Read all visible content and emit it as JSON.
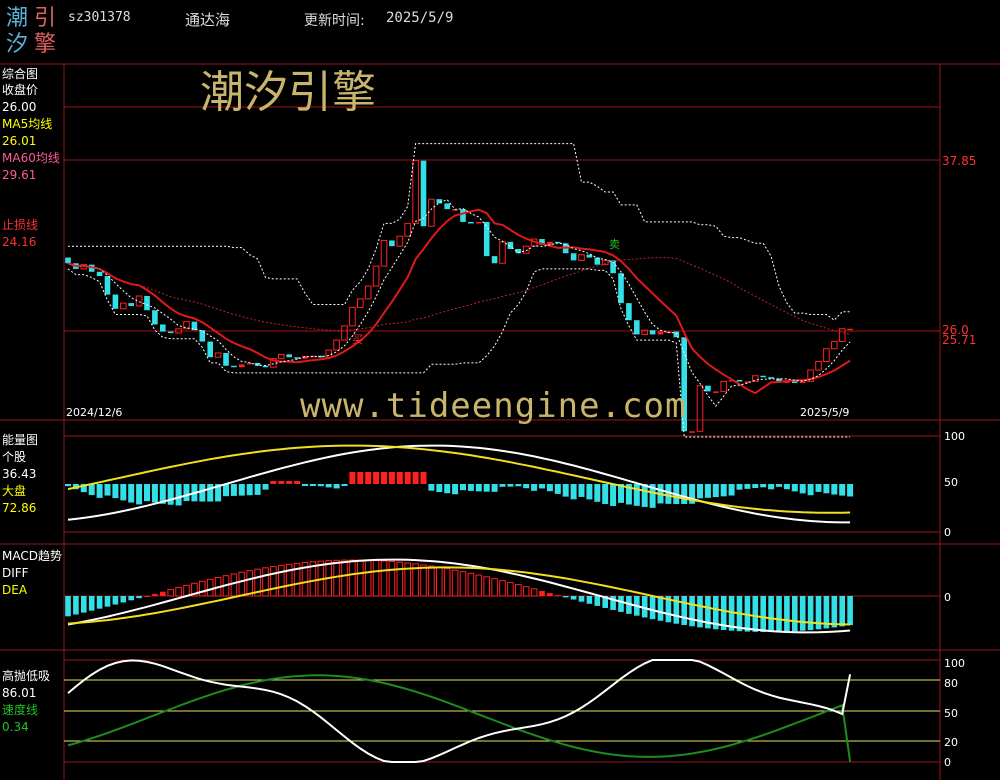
{
  "header": {
    "logo_chars": [
      "潮",
      "引",
      "汐",
      "擎"
    ],
    "code": "sz301378",
    "name": "通达海",
    "update_label": "更新时间:",
    "update_date": "2025/5/9"
  },
  "watermarks": {
    "brand": "潮汐引擎",
    "url": "www.tideengine.com"
  },
  "panels": {
    "main": {
      "title": "综合图",
      "close_label": "收盘价",
      "close_value": "26.00",
      "ma5_label": "MA5均线",
      "ma5_value": "26.01",
      "ma60_label": "MA60均线",
      "ma60_value": "29.61",
      "stop_label": "止损线",
      "stop_value": "24.16",
      "date_start": "2024/12/6",
      "date_end": "2025/5/9",
      "right_top": "37.85",
      "right_mid1": "26.0",
      "right_mid2": "25.71",
      "marker_red": "买",
      "marker_green": "卖"
    },
    "energy": {
      "title": "能量图",
      "stock_label": "个股",
      "stock_value": "36.43",
      "market_label": "大盘",
      "market_value": "72.86",
      "axis": [
        "100",
        "50",
        "0"
      ]
    },
    "macd": {
      "title": "MACD趋势",
      "diff_label": "DIFF",
      "dea_label": "DEA",
      "axis": [
        "0"
      ]
    },
    "hilo": {
      "title": "高抛低吸",
      "value": "86.01",
      "speed_label": "速度线",
      "speed_value": "0.34",
      "axis": [
        "100",
        "80",
        "50",
        "20",
        "0"
      ]
    }
  },
  "colors": {
    "up": "#ff2020",
    "down": "#33e0e8",
    "ma60": "#e01818",
    "band": "#ffffff",
    "white_line": "#ffffff",
    "yellow_line": "#f0e020",
    "green_line": "#1e8c1e",
    "grid": "#9b1515",
    "label_yellow": "#ffff00",
    "label_pink": "#ff5a9a",
    "label_red": "#ff3030",
    "label_green": "#20c020",
    "watermark": "#c8b46a"
  },
  "chart_data": [
    {
      "type": "candlestick",
      "title": "综合图",
      "x_range": [
        "2024/12/6",
        "2025/5/9"
      ],
      "y_marks": [
        37.85,
        26.0,
        25.71
      ],
      "close": [
        30.6,
        30.2,
        30.5,
        30.0,
        29.7,
        28.4,
        27.4,
        27.8,
        27.6,
        28.3,
        27.3,
        26.3,
        25.8,
        25.7,
        26.0,
        26.5,
        25.9,
        25.1,
        24.0,
        24.3,
        23.4,
        23.3,
        23.5,
        23.6,
        23.4,
        23.3,
        23.9,
        24.2,
        24.0,
        23.9,
        24.1,
        24.1,
        24.0,
        24.5,
        25.2,
        26.2,
        27.5,
        28.1,
        29.0,
        30.4,
        32.2,
        31.8,
        32.5,
        33.4,
        37.8,
        33.2,
        35.1,
        34.8,
        34.4,
        34.4,
        33.5,
        33.4,
        33.5,
        31.1,
        30.6,
        32.1,
        31.6,
        31.3,
        31.8,
        32.3,
        31.9,
        32.1,
        32.0,
        31.3,
        30.8,
        31.2,
        31.0,
        30.5,
        30.8,
        29.9,
        27.8,
        26.6,
        25.6,
        25.9,
        25.6,
        25.8,
        25.8,
        25.4,
        18.8,
        18.8,
        22.0,
        21.6,
        21.6,
        22.3,
        22.4,
        22.3,
        22.3,
        22.7,
        22.6,
        22.5,
        22.3,
        22.3,
        22.2,
        22.3,
        23.1,
        23.7,
        24.6,
        25.1,
        26.0,
        26.0
      ],
      "ma60_end": 29.61,
      "stop_line_end": 24.16,
      "markers": [
        {
          "text": "买",
          "index": 40
        },
        {
          "text": "卖",
          "index": 81
        }
      ]
    },
    {
      "type": "bar+line",
      "title": "能量图",
      "ylim": [
        0,
        100
      ],
      "series": [
        {
          "name": "个股",
          "last": 36.43
        },
        {
          "name": "大盘",
          "last": 72.86
        }
      ]
    },
    {
      "type": "bar+line",
      "title": "MACD趋势",
      "series": [
        {
          "name": "DIFF"
        },
        {
          "name": "DEA"
        }
      ]
    },
    {
      "type": "line",
      "title": "高抛低吸",
      "ylim": [
        0,
        100
      ],
      "reference_lines": [
        80,
        50,
        20
      ],
      "series": [
        {
          "name": "高抛低吸",
          "last": 86.01
        },
        {
          "name": "速度线",
          "last": 0.34
        }
      ]
    }
  ]
}
